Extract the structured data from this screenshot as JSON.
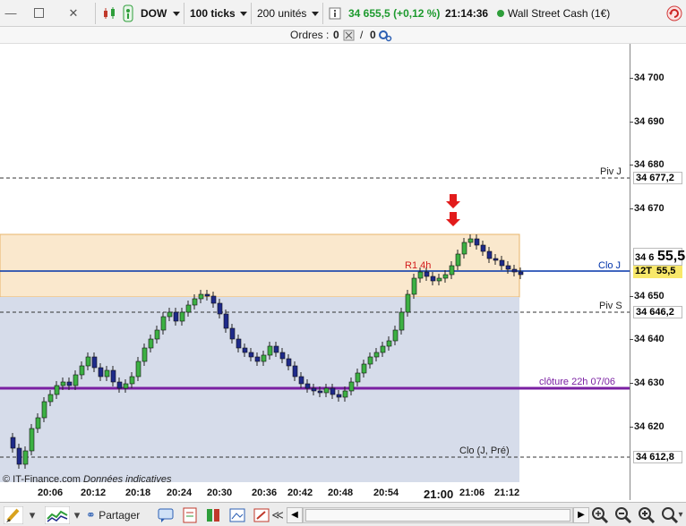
{
  "toolbar": {
    "symbol": "DOW",
    "tick_mode": "100 ticks",
    "units": "200 unités",
    "price": "34 655,5",
    "change": "(+0,12 %)",
    "time": "21:14:36",
    "instrument": "Wall Street Cash (1€)"
  },
  "orders": {
    "label": "Ordres :",
    "buy_count": "0",
    "separator": "/",
    "sell_count": "0"
  },
  "chart": {
    "price_ticks": [
      "34 700",
      "34 690",
      "34 680",
      "34 670",
      "34 660",
      "34 650",
      "34 640",
      "34 630",
      "34 620"
    ],
    "time_ticks": [
      "20:06",
      "20:12",
      "20:18",
      "20:24",
      "20:30",
      "20:36",
      "20:42",
      "20:48",
      "20:54",
      "21:00",
      "21:06",
      "21:12"
    ],
    "lines": {
      "piv_j": {
        "label": "Piv J",
        "value": "34 677,2"
      },
      "clo_j": {
        "label": "Clo J",
        "value": "34 655,5"
      },
      "piv_s": {
        "label": "Piv S",
        "value": "34 646,2"
      },
      "cloture": {
        "label": "clôture 22h 07/06"
      },
      "clo_pre": {
        "label": "Clo (J, Pré)",
        "value": "34 612,8"
      },
      "r1": {
        "label": "R1 4h"
      }
    },
    "current_price_big": "55,5",
    "current_price_prefix": "34 6",
    "tick_count_badge": "12T",
    "current_badge": "55,5",
    "copyright": "© IT-Finance.com",
    "disclaimer": "Données indicatives",
    "colors": {
      "up": "#3cb043",
      "down": "#1e2a8a",
      "clo_line": "#0033aa",
      "purple_line": "#7a1fa2",
      "zone": "#f9e4c4",
      "lower_zone": "#d6dcea",
      "arrow": "#e21b1b"
    }
  },
  "bottom": {
    "share_label": "Partager"
  }
}
